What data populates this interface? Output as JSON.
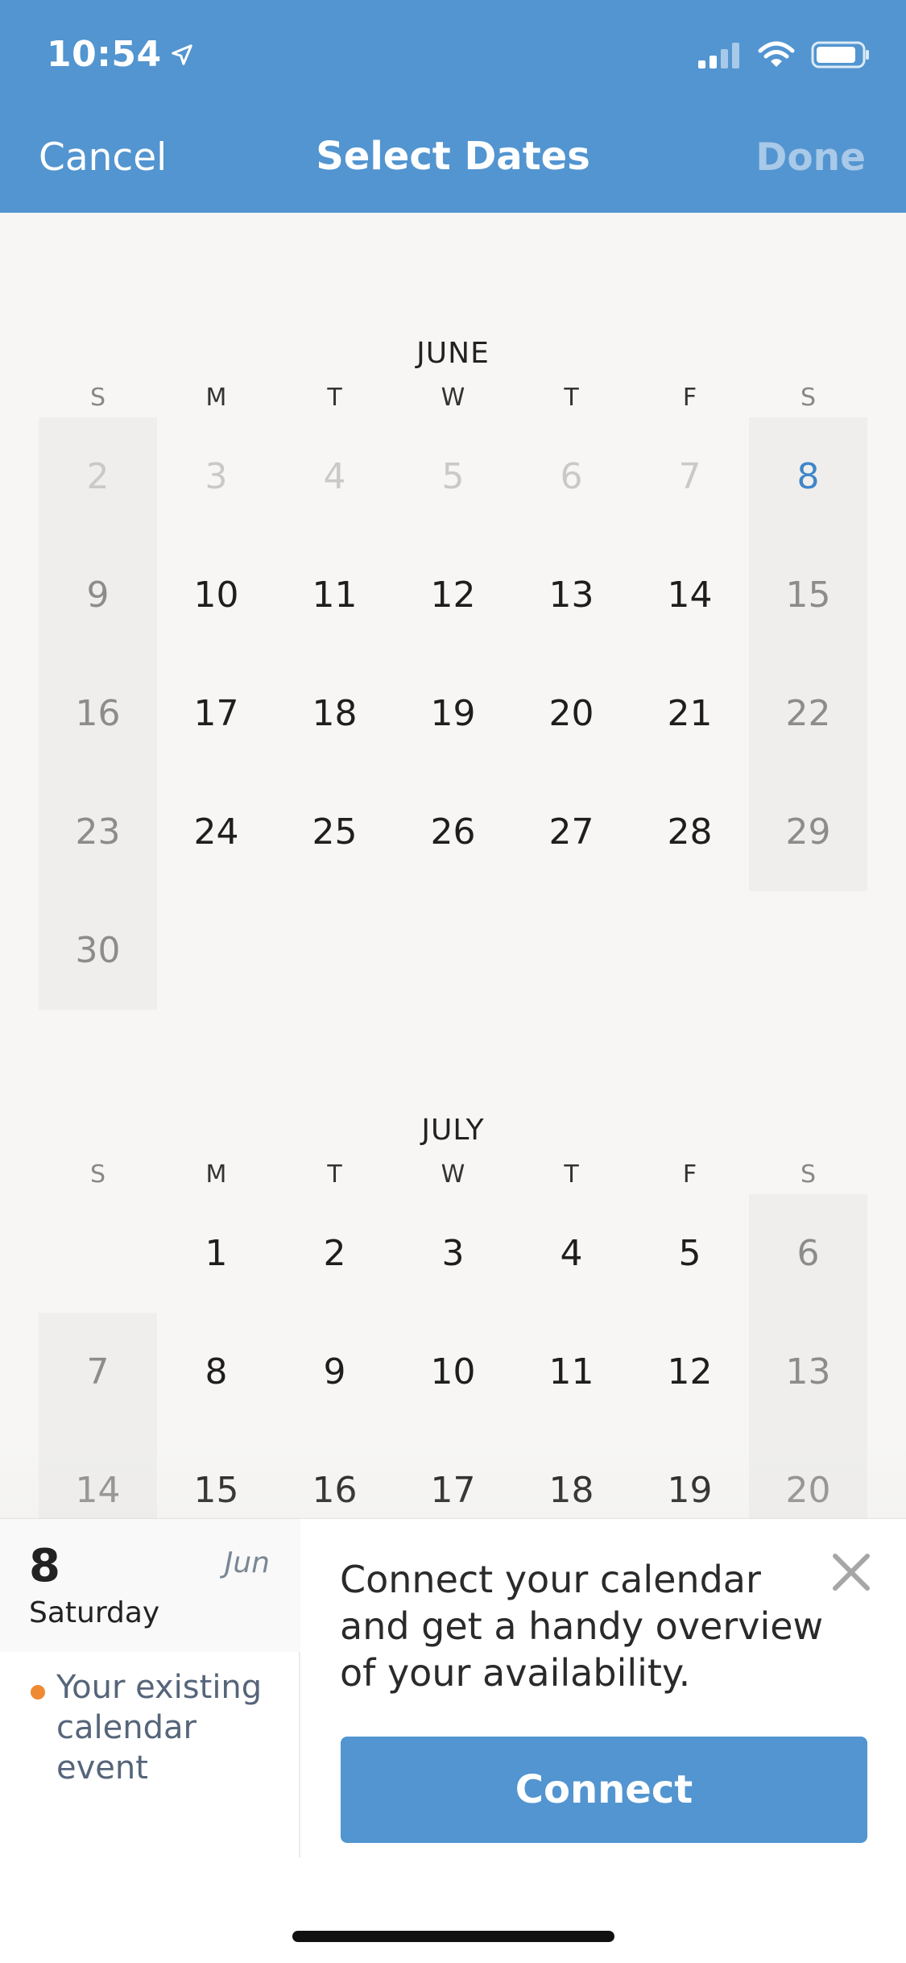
{
  "status_bar": {
    "time": "10:54"
  },
  "nav": {
    "cancel": "Cancel",
    "title": "Select Dates",
    "done": "Done"
  },
  "weekdays": [
    "S",
    "M",
    "T",
    "W",
    "T",
    "F",
    "S"
  ],
  "months": [
    {
      "name": "JUNE",
      "rows": [
        [
          {
            "d": "2",
            "s": "past"
          },
          {
            "d": "3",
            "s": "past"
          },
          {
            "d": "4",
            "s": "past"
          },
          {
            "d": "5",
            "s": "past"
          },
          {
            "d": "6",
            "s": "past"
          },
          {
            "d": "7",
            "s": "past"
          },
          {
            "d": "8",
            "s": "selected"
          }
        ],
        [
          {
            "d": "9"
          },
          {
            "d": "10"
          },
          {
            "d": "11"
          },
          {
            "d": "12"
          },
          {
            "d": "13"
          },
          {
            "d": "14"
          },
          {
            "d": "15"
          }
        ],
        [
          {
            "d": "16"
          },
          {
            "d": "17"
          },
          {
            "d": "18"
          },
          {
            "d": "19"
          },
          {
            "d": "20"
          },
          {
            "d": "21"
          },
          {
            "d": "22"
          }
        ],
        [
          {
            "d": "23"
          },
          {
            "d": "24"
          },
          {
            "d": "25"
          },
          {
            "d": "26"
          },
          {
            "d": "27"
          },
          {
            "d": "28"
          },
          {
            "d": "29"
          }
        ],
        [
          {
            "d": "30"
          },
          null,
          null,
          null,
          null,
          null,
          null
        ]
      ]
    },
    {
      "name": "JULY",
      "rows": [
        [
          null,
          {
            "d": "1"
          },
          {
            "d": "2"
          },
          {
            "d": "3"
          },
          {
            "d": "4"
          },
          {
            "d": "5"
          },
          {
            "d": "6"
          }
        ],
        [
          {
            "d": "7"
          },
          {
            "d": "8"
          },
          {
            "d": "9"
          },
          {
            "d": "10"
          },
          {
            "d": "11"
          },
          {
            "d": "12"
          },
          {
            "d": "13"
          }
        ],
        [
          {
            "d": "14"
          },
          {
            "d": "15"
          },
          {
            "d": "16"
          },
          {
            "d": "17"
          },
          {
            "d": "18"
          },
          {
            "d": "19"
          },
          {
            "d": "20"
          }
        ]
      ]
    }
  ],
  "day_card": {
    "day_number": "8",
    "month": "Jun",
    "weekday": "Saturday",
    "event_label": "Your existing calendar event",
    "event_color": "#ef8a34"
  },
  "promo": {
    "text": "Connect your calendar and get a handy overview of your availability.",
    "button": "Connect"
  },
  "colors": {
    "accent": "#5295d0",
    "selected_day": "#3f86c8"
  }
}
